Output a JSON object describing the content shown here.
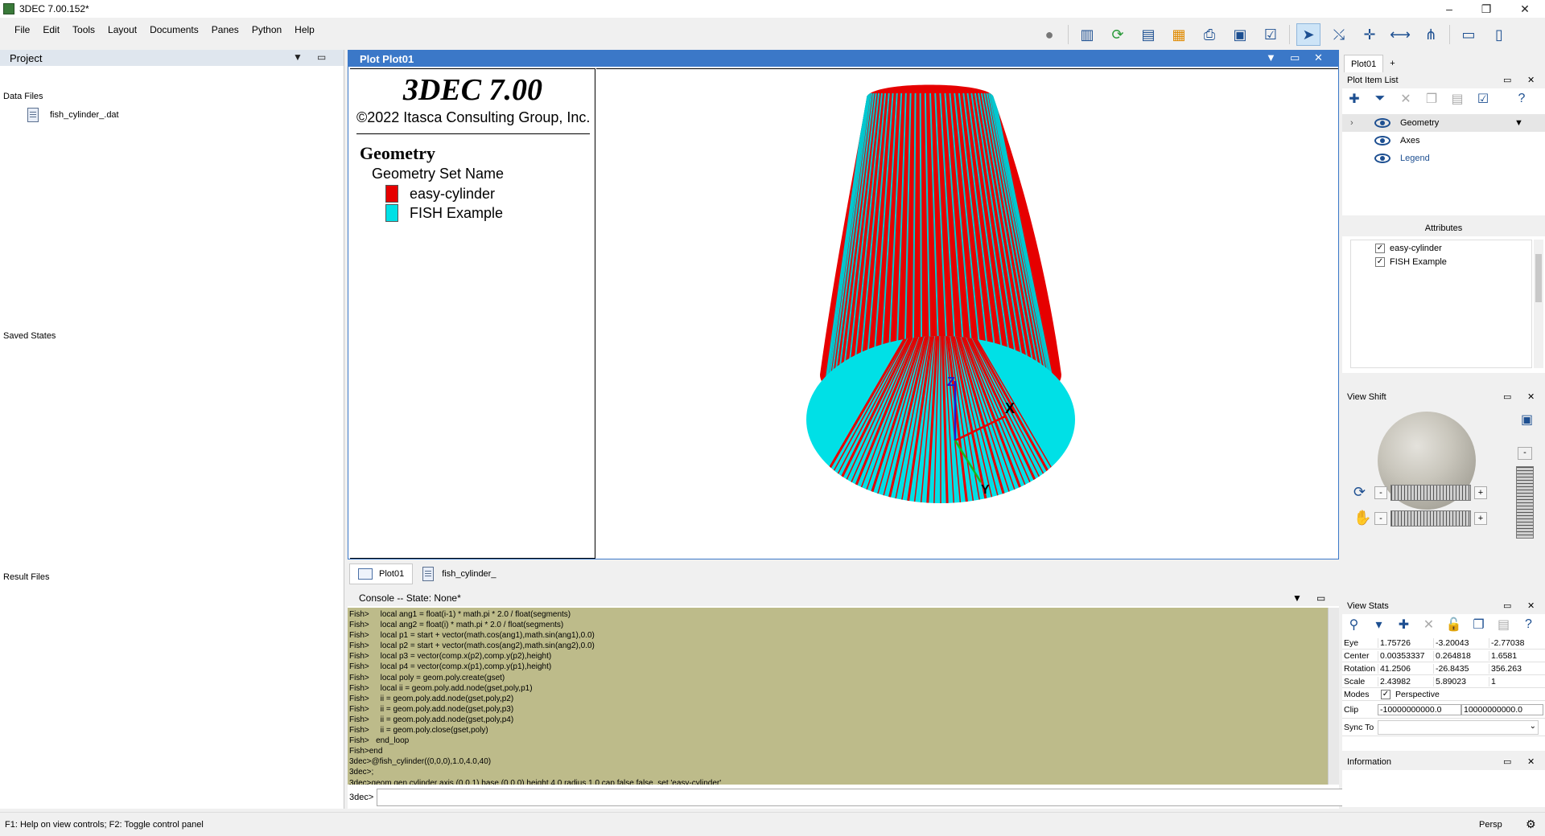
{
  "window": {
    "title": "3DEC 7.00.152*",
    "min": "–",
    "restore": "❐",
    "close": "✕"
  },
  "menu": [
    "File",
    "Edit",
    "Tools",
    "Layout",
    "Documents",
    "Panes",
    "Python",
    "Help"
  ],
  "project": {
    "title": "Project",
    "sections": {
      "data_files": "Data Files",
      "saved_states": "Saved States",
      "result_files": "Result Files"
    },
    "files": [
      "fish_cylinder_.dat"
    ]
  },
  "plot": {
    "title": "Plot Plot01",
    "legend": {
      "app_title": "3DEC 7.00",
      "copyright": "©2022 Itasca Consulting Group, Inc.",
      "section": "Geometry",
      "subsection": "Geometry Set Name",
      "items": [
        {
          "label": "easy-cylinder",
          "color": "#e60000"
        },
        {
          "label": "FISH Example",
          "color": "#00e0e6"
        }
      ]
    },
    "axes": {
      "x": "X",
      "y": "Y",
      "z": "Z"
    }
  },
  "plot_tabs": [
    "Plot01",
    "fish_cylinder_"
  ],
  "console": {
    "title": "Console -- State: None*",
    "lines": [
      "Fish>     local ang1 = float(i-1) * math.pi * 2.0 / float(segments)",
      "Fish>     local ang2 = float(i) * math.pi * 2.0 / float(segments)",
      "Fish>     local p1 = start + vector(math.cos(ang1),math.sin(ang1),0.0)",
      "Fish>     local p2 = start + vector(math.cos(ang2),math.sin(ang2),0.0)",
      "Fish>     local p3 = vector(comp.x(p2),comp.y(p2),height)",
      "Fish>     local p4 = vector(comp.x(p1),comp.y(p1),height)",
      "Fish>     local poly = geom.poly.create(gset)",
      "Fish>     local ii = geom.poly.add.node(gset,poly,p1)",
      "Fish>     ii = geom.poly.add.node(gset,poly,p2)",
      "Fish>     ii = geom.poly.add.node(gset,poly,p3)",
      "Fish>     ii = geom.poly.add.node(gset,poly,p4)",
      "Fish>     ii = geom.poly.close(gset,poly)",
      "Fish>   end_loop",
      "Fish>end",
      "3dec>@fish_cylinder((0,0,0),1.0,4.0,40)",
      "3dec>;",
      "3dec>geom gen cylinder axis (0,0,1) base (0,0,0) height 4.0 radius 1.0 cap false false  set 'easy-cylinder'"
    ],
    "prompt": "3dec>",
    "input_value": "",
    "run_symbol": ">_"
  },
  "right_panel": {
    "tab": "Plot01",
    "add_tab": "+",
    "plot_item_list": {
      "title": "Plot Item List",
      "items": [
        {
          "label": "Geometry",
          "selected": true
        },
        {
          "label": "Axes"
        },
        {
          "label": "Legend",
          "link": true
        }
      ]
    },
    "attributes": {
      "title": "Attributes",
      "checks": [
        {
          "label": "easy-cylinder",
          "checked": true
        },
        {
          "label": "FISH Example",
          "checked": true
        }
      ]
    },
    "view_shift": {
      "title": "View Shift",
      "minus": "-",
      "plus": "+"
    },
    "view_stats": {
      "title": "View Stats",
      "rows": [
        {
          "key": "Eye",
          "v1": "1.75726",
          "v2": "-3.20043",
          "v3": "-2.77038"
        },
        {
          "key": "Center",
          "v1": "0.00353337",
          "v2": "0.264818",
          "v3": "1.6581"
        },
        {
          "key": "Rotation",
          "v1": "41.2506",
          "v2": "-26.8435",
          "v3": "356.263"
        },
        {
          "key": "Scale",
          "v1": "2.43982",
          "v2": "5.89023",
          "v3": "1"
        }
      ],
      "modes_label": "Modes",
      "perspective_label": "Perspective",
      "clip_label": "Clip",
      "clip_min": "-10000000000.0",
      "clip_max": "10000000000.0",
      "sync_label": "Sync To"
    },
    "information": {
      "title": "Information"
    }
  },
  "status": {
    "left": "F1: Help on view controls; F2: Toggle control panel",
    "mode": "Persp"
  }
}
